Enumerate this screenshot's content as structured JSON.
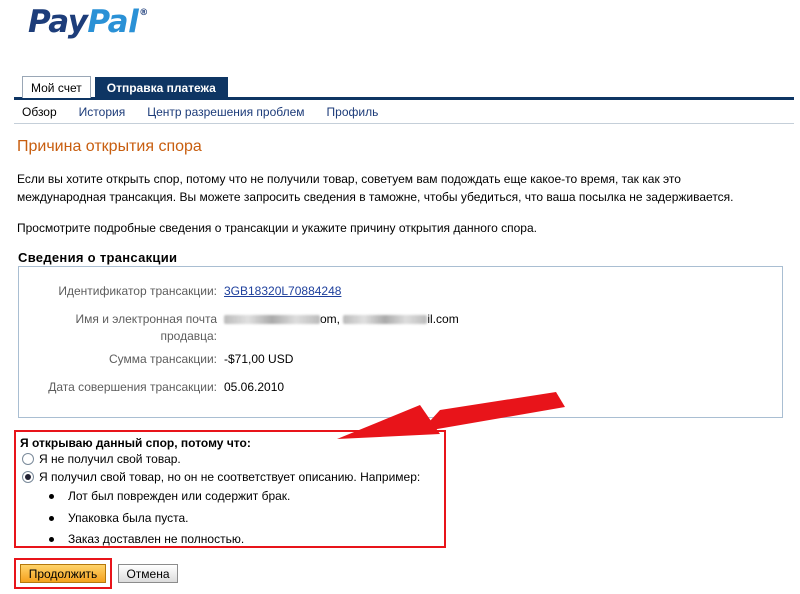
{
  "logo": {
    "part1": "Pay",
    "part2": "Pal",
    "trademark": "®"
  },
  "tabs": [
    {
      "label": "Мой счет",
      "active": true
    },
    {
      "label": "Отправка платежа",
      "active": false
    }
  ],
  "subnav": [
    {
      "label": "Обзор",
      "current": true
    },
    {
      "label": "История",
      "current": false
    },
    {
      "label": "Центр разрешения проблем",
      "current": false
    },
    {
      "label": "Профиль",
      "current": false
    }
  ],
  "page_title": "Причина открытия спора",
  "intro": {
    "line1": "Если вы хотите открыть спор, потому что не получили товар, советуем вам подождать еще какое-то время, так как это",
    "line2": "международная трансакция. Вы можете запросить сведения в таможне, чтобы убедиться, что ваша посылка не задерживается.",
    "instruction": "Просмотрите подробные сведения о трансакции и укажите причину открытия данного спора."
  },
  "details": {
    "title": "Сведения о трансакции",
    "transaction_id_label": "Идентификатор трансакции:",
    "transaction_id": "3GB18320L70884248",
    "seller_label_line1": "Имя и электронная почта",
    "seller_label_line2": "продавца:",
    "seller_suffix_1": "om,",
    "seller_suffix_2": "il.com",
    "amount_label": "Сумма трансакции:",
    "amount": "-$71,00 USD",
    "date_label": "Дата совершения трансакции:",
    "date": "05.06.2010"
  },
  "reason": {
    "question": "Я открываю данный спор, потому что:",
    "option1": "Я не получил свой товар.",
    "option2": "Я получил свой товар, но он не соответствует описанию. Например:",
    "selected": 2,
    "examples": [
      "Лот был поврежден или содержит брак.",
      "Упаковка была пуста.",
      "Заказ доставлен не полностью."
    ]
  },
  "buttons": {
    "continue": "Продолжить",
    "cancel": "Отмена"
  },
  "colors": {
    "brand_dark": "#1d3d7a",
    "brand_light": "#2a91d6",
    "title_orange": "#c85e0f",
    "annotation_red": "#e8141a",
    "nav_dark": "#0e3563"
  }
}
